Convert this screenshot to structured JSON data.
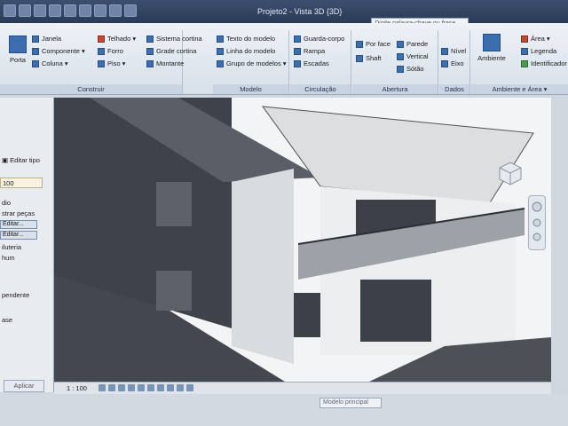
{
  "title": "Projeto2 - Vista 3D {3D}",
  "search": {
    "placeholder": "Digite palavra-chave ou frase"
  },
  "ribbon": {
    "panels": [
      {
        "label": "Construir"
      },
      {
        "label": "Modelo"
      },
      {
        "label": "Circulação"
      },
      {
        "label": "Abertura"
      },
      {
        "label": "Dados"
      },
      {
        "label": "Ambiente e Área ▾"
      }
    ],
    "build": {
      "porta": "Porta",
      "janela": "Janela",
      "componente": "Componente ▾",
      "coluna": "Coluna ▾",
      "telhado": "Telhado ▾",
      "forro": "Forro",
      "piso": "Piso ▾",
      "sistema_cortina": "Sistema cortina",
      "grade_cortina": "Grade cortina",
      "montante": "Montante"
    },
    "model": {
      "texto": "Texto do modelo",
      "linha": "Linha do modelo",
      "grupo": "Grupo de modelos ▾"
    },
    "circulation": {
      "guarda_corpo": "Guarda-corpo",
      "rampa": "Rampa",
      "escadas": "Escadas"
    },
    "opening": {
      "por_face": "Por face",
      "shaft": "Shaft",
      "parede": "Parede",
      "vertical": "Vertical",
      "sotao": "Sótão"
    },
    "datum": {
      "nivel": "Nível",
      "eixo": "Eixo"
    },
    "room": {
      "ambiente": "Ambiente",
      "area": "Área ▾",
      "legenda": "Legenda",
      "identificador": "Identificador"
    }
  },
  "properties": {
    "edit_type": "Editar tipo",
    "value_100": "100",
    "fields": [
      "dio",
      "strar peças",
      "Editar...",
      "Editar...",
      "iluteria",
      "hum"
    ],
    "dependente": "pendente",
    "ase": "ase",
    "apply": "Aplicar"
  },
  "statusbar": {
    "scale": "1 : 100",
    "modelo_principal": "Modelo principal"
  }
}
